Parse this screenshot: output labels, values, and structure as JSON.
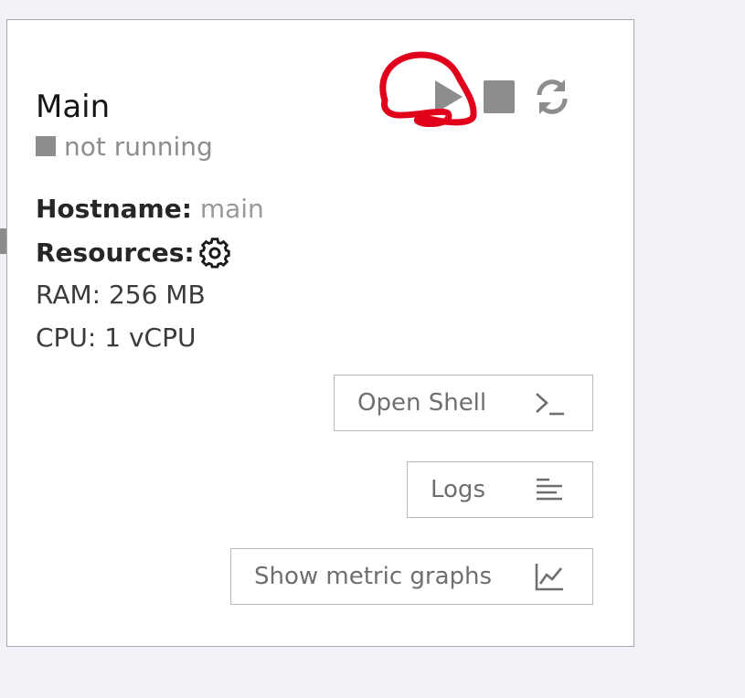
{
  "card": {
    "title": "Main",
    "status": {
      "text": "not running",
      "icon": "stopped-square-icon",
      "color": "#8d8d8d"
    },
    "controls": {
      "play_icon": "play-icon",
      "stop_icon": "stop-icon",
      "refresh_icon": "refresh-icon"
    },
    "hostname": {
      "label": "Hostname:",
      "value": "main"
    },
    "resources": {
      "label": "Resources:",
      "icon": "gear-icon"
    },
    "ram": "RAM: 256 MB",
    "cpu": "CPU: 1 vCPU",
    "buttons": {
      "open_shell": {
        "label": "Open Shell",
        "icon": "terminal-prompt-icon"
      },
      "logs": {
        "label": "Logs",
        "icon": "text-lines-icon"
      },
      "metrics": {
        "label": "Show metric graphs",
        "icon": "line-chart-icon"
      }
    }
  },
  "colors": {
    "annotation": "#e0001b",
    "muted": "#8d8d8d",
    "text": "#161616"
  }
}
